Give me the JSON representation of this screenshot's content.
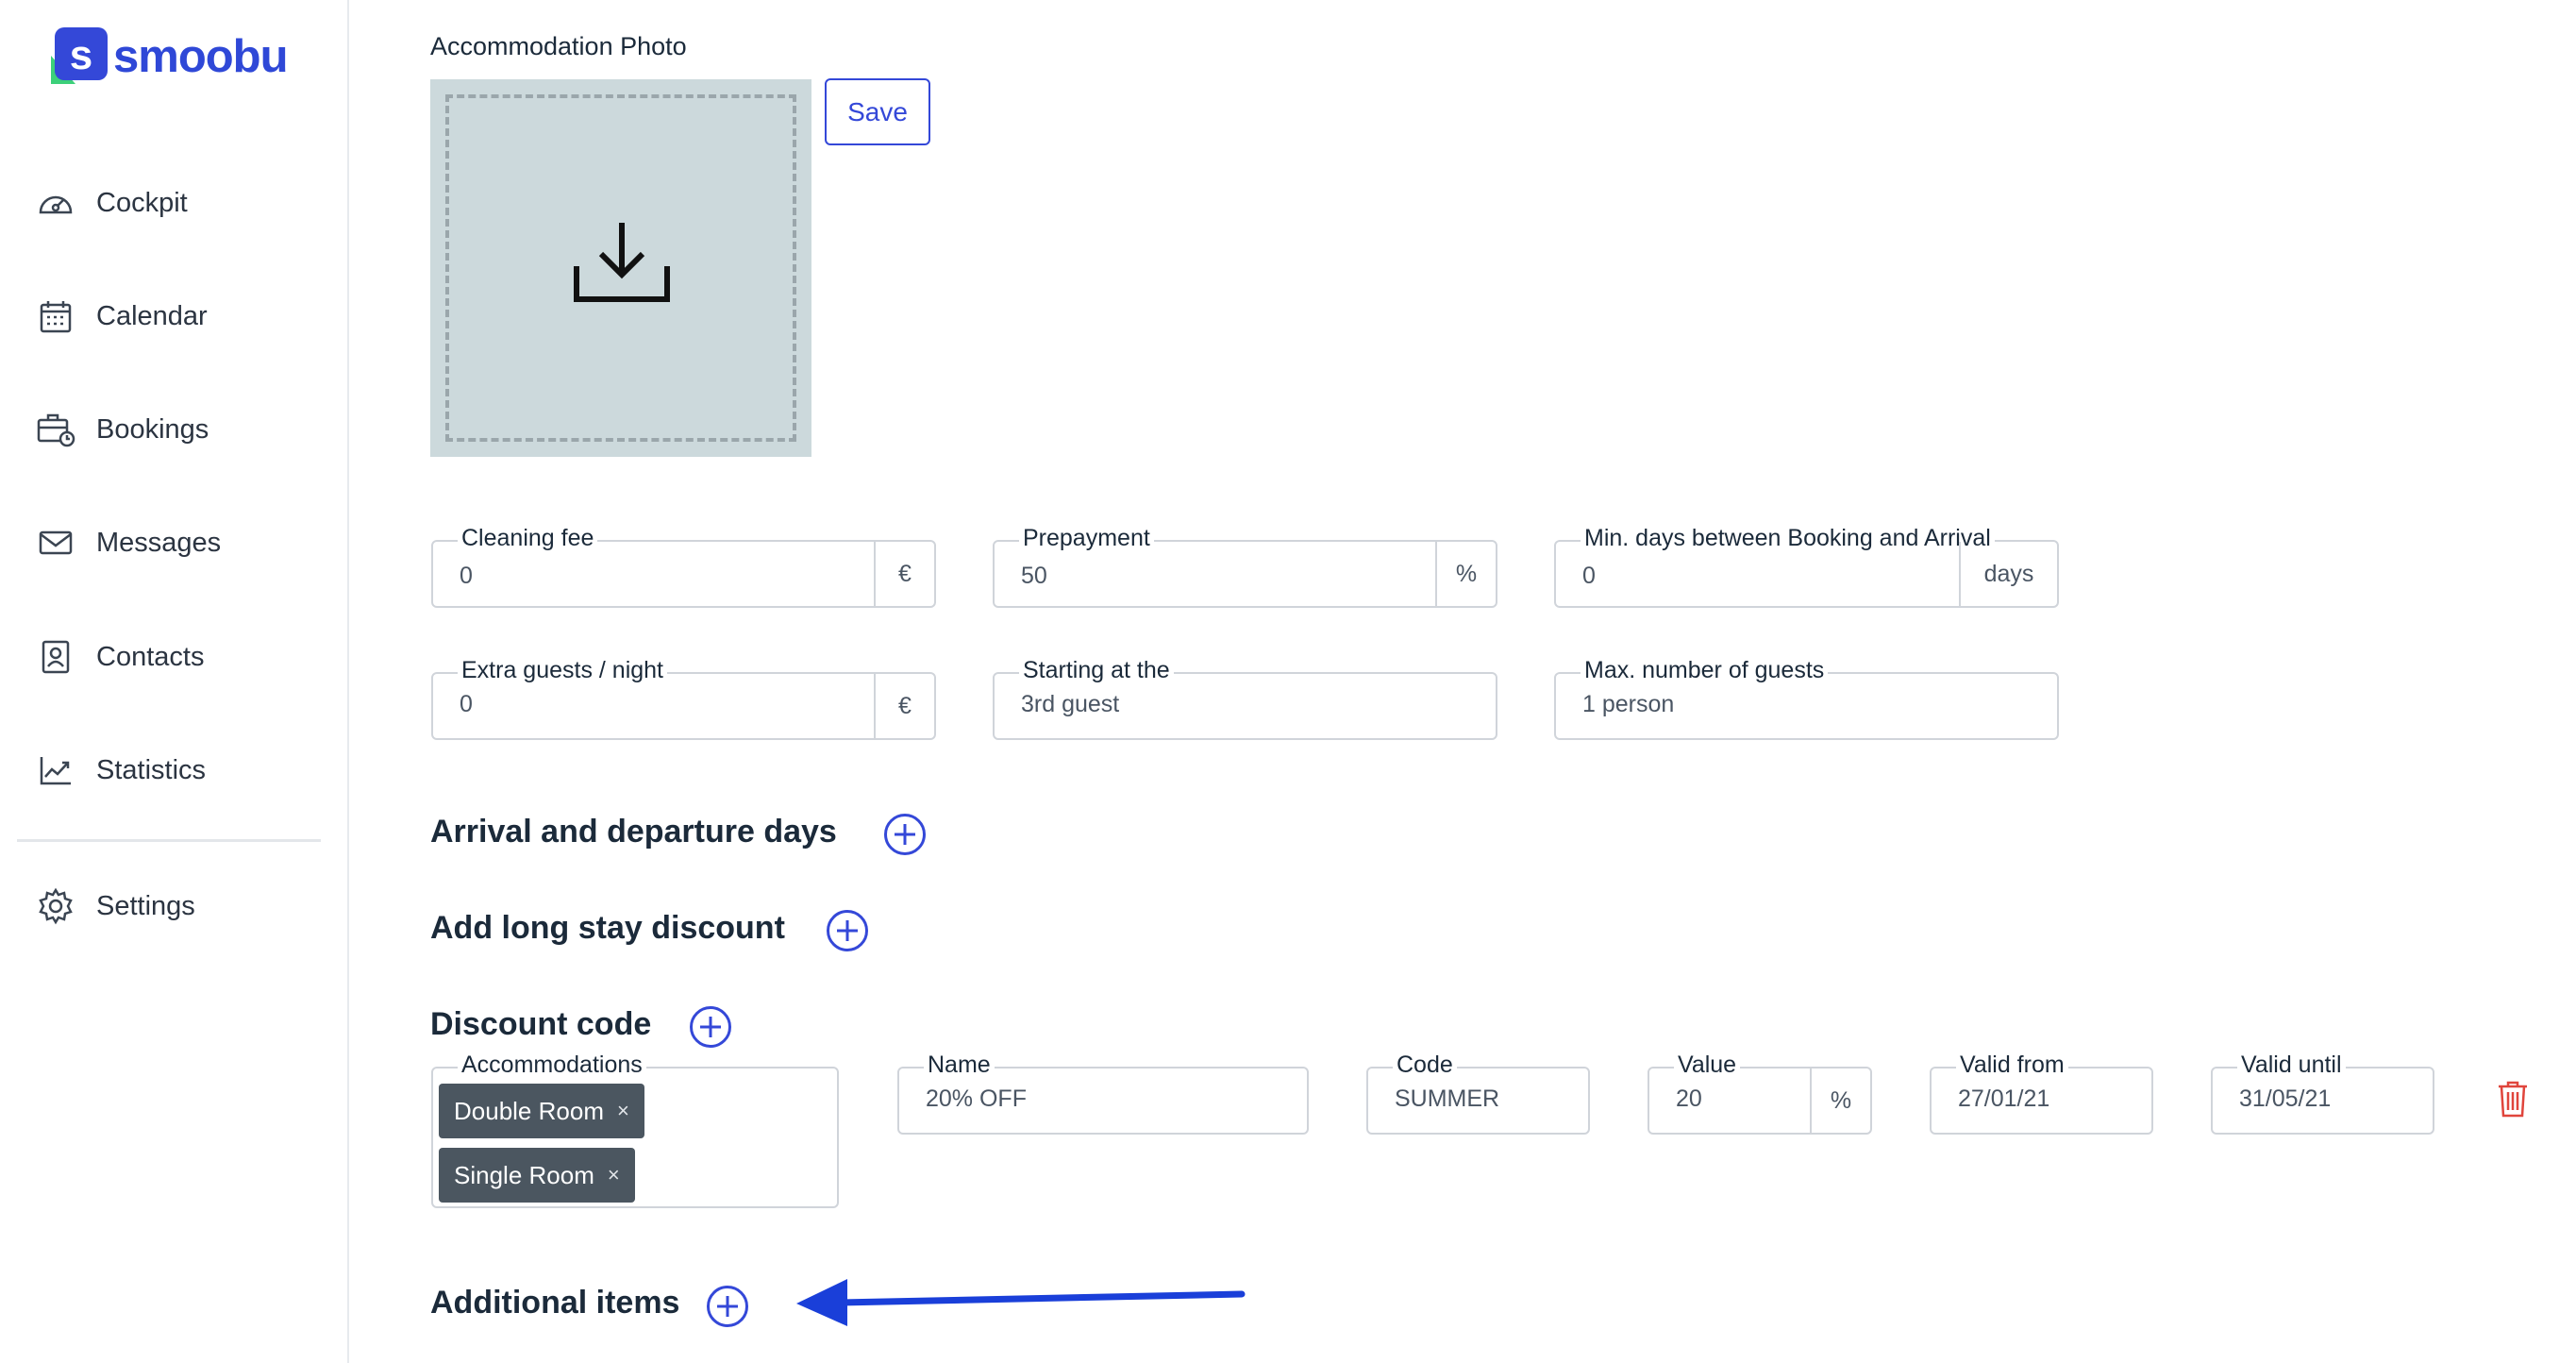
{
  "sidebar": {
    "logo_text": "smoobu",
    "items": [
      {
        "label": "Cockpit",
        "icon": "dashboard-icon"
      },
      {
        "label": "Calendar",
        "icon": "calendar-icon"
      },
      {
        "label": "Bookings",
        "icon": "bookings-icon"
      },
      {
        "label": "Messages",
        "icon": "envelope-icon"
      },
      {
        "label": "Contacts",
        "icon": "contact-card-icon"
      },
      {
        "label": "Statistics",
        "icon": "chart-icon"
      },
      {
        "label": "Settings",
        "icon": "gear-icon"
      }
    ]
  },
  "photo": {
    "label": "Accommodation Photo",
    "save_label": "Save",
    "icon": "download-icon"
  },
  "fields": {
    "cleaning_fee": {
      "label": "Cleaning fee",
      "value": "0",
      "unit": "€"
    },
    "prepayment": {
      "label": "Prepayment",
      "value": "50",
      "unit": "%"
    },
    "min_days": {
      "label": "Min. days between Booking and Arrival",
      "value": "0",
      "unit": "days"
    },
    "extra_guests": {
      "label": "Extra guests / night",
      "value": "0",
      "unit": "€"
    },
    "starting_at": {
      "label": "Starting at the",
      "value": "3rd guest"
    },
    "max_guests": {
      "label": "Max. number of guests",
      "value": "1 person"
    }
  },
  "sections": {
    "arrival_departure": "Arrival and departure days",
    "long_stay": "Add long stay discount",
    "discount_code": "Discount code",
    "additional_items": "Additional items"
  },
  "discount": {
    "accommodations_label": "Accommodations",
    "accommodations": [
      "Double Room",
      "Single Room"
    ],
    "chip_remove": "×",
    "name": {
      "label": "Name",
      "value": "20% OFF"
    },
    "code": {
      "label": "Code",
      "value": "SUMMER"
    },
    "value": {
      "label": "Value",
      "value": "20",
      "unit": "%"
    },
    "valid_from": {
      "label": "Valid from",
      "value": "27/01/21"
    },
    "valid_until": {
      "label": "Valid until",
      "value": "31/05/21"
    }
  },
  "colors": {
    "accent": "#3448d8",
    "arrow": "#1a3fd9",
    "delete": "#e0453c",
    "chip": "#4b5660"
  }
}
